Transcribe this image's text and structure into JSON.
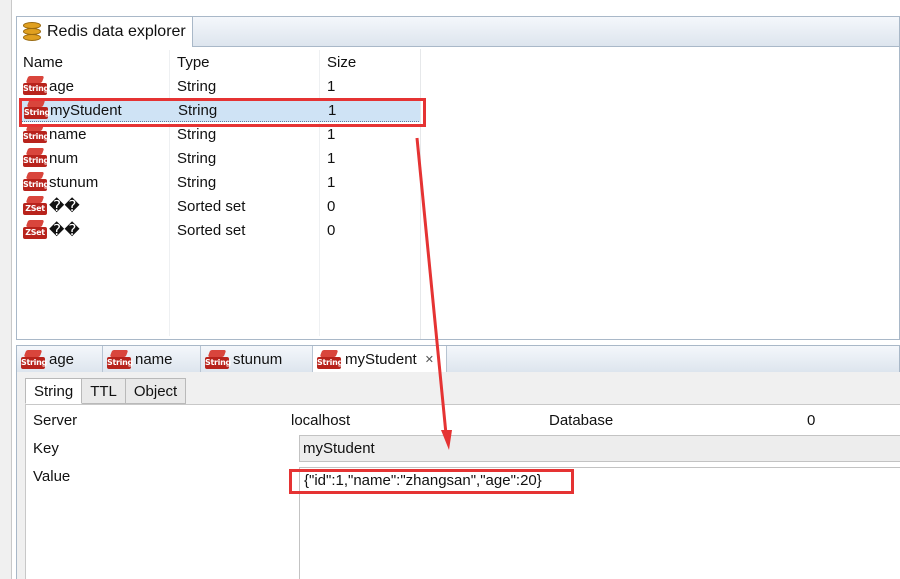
{
  "explorer": {
    "title": "Redis data explorer",
    "columns": [
      "Name",
      "Type",
      "Size"
    ],
    "rows": [
      {
        "name": "age",
        "type": "String",
        "size": "1",
        "icon": "String"
      },
      {
        "name": "myStudent",
        "type": "String",
        "size": "1",
        "icon": "String"
      },
      {
        "name": "name",
        "type": "String",
        "size": "1",
        "icon": "String"
      },
      {
        "name": "num",
        "type": "String",
        "size": "1",
        "icon": "String"
      },
      {
        "name": "stunum",
        "type": "String",
        "size": "1",
        "icon": "String"
      },
      {
        "name": "��",
        "type": "Sorted set",
        "size": "0",
        "icon": "ZSet"
      },
      {
        "name": "��",
        "type": "Sorted set",
        "size": "0",
        "icon": "ZSet"
      }
    ]
  },
  "editor_tabs": [
    {
      "label": "age",
      "icon": "String"
    },
    {
      "label": "name",
      "icon": "String"
    },
    {
      "label": "stunum",
      "icon": "String"
    },
    {
      "label": "myStudent",
      "icon": "String",
      "close": "✕"
    }
  ],
  "detail": {
    "subtabs": [
      "String",
      "TTL",
      "Object"
    ],
    "server_label": "Server",
    "server_value": "localhost",
    "database_label": "Database",
    "database_value": "0",
    "key_label": "Key",
    "key_value": "myStudent",
    "value_label": "Value",
    "value_text": "{\"id\":1,\"name\":\"zhangsan\",\"age\":20}"
  },
  "colors": {
    "highlight": "#e53333",
    "selection": "#cfe3f5",
    "redis_red": "#b8231c"
  }
}
